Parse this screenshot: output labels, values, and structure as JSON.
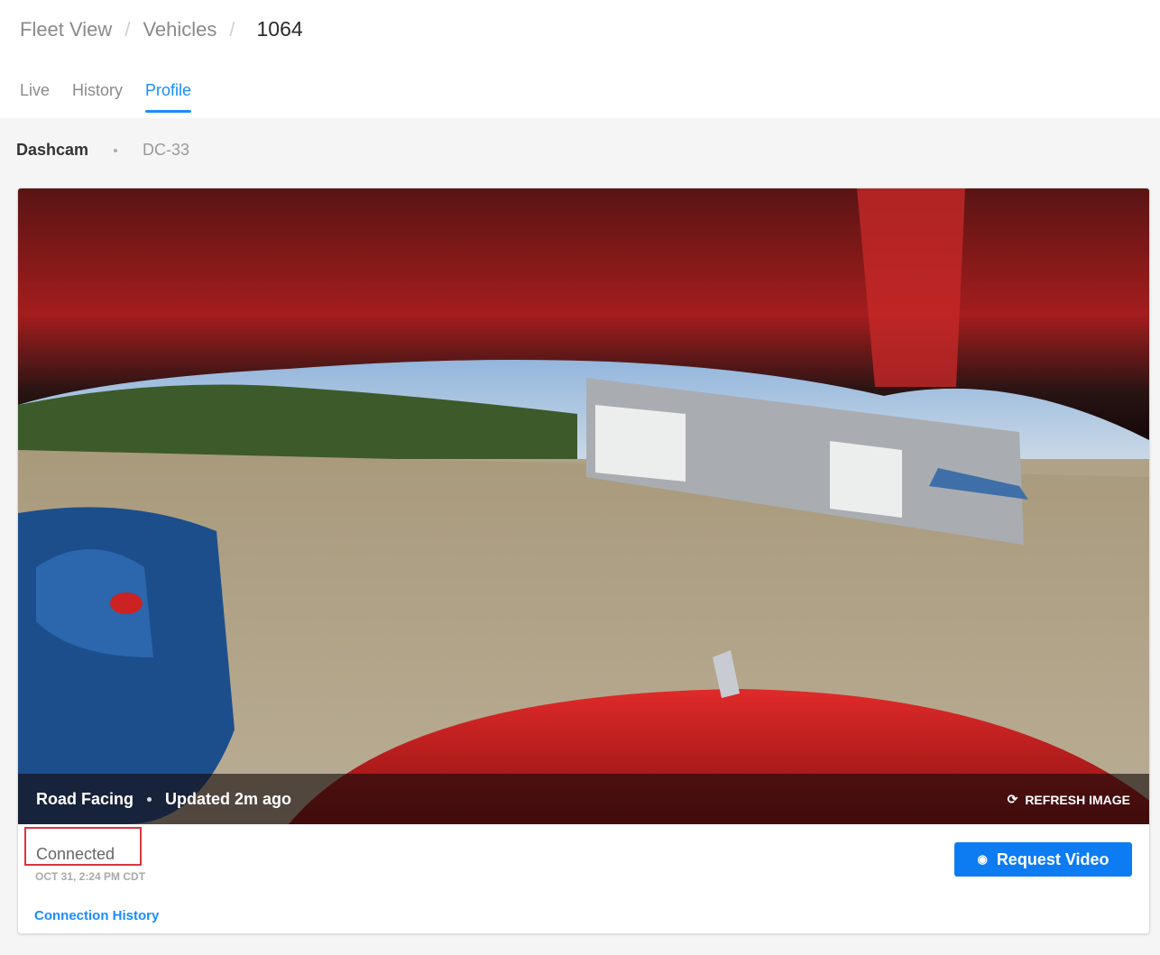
{
  "breadcrumb": {
    "items": [
      "Fleet View",
      "Vehicles"
    ],
    "current": "1064"
  },
  "tabs": [
    {
      "label": "Live"
    },
    {
      "label": "History"
    },
    {
      "label": "Profile",
      "active": true
    }
  ],
  "device": {
    "type": "Dashcam",
    "id": "DC-33"
  },
  "camera": {
    "view": "Road Facing",
    "updated": "Updated 2m ago",
    "refresh_label": "REFRESH IMAGE"
  },
  "connection": {
    "status": "Connected",
    "timestamp": "OCT 31, 2:24 PM CDT",
    "history_link": "Connection History"
  },
  "actions": {
    "request_video": "Request Video"
  },
  "colors": {
    "accent": "#1a8cff",
    "button": "#0d7cf2",
    "highlight": "#d9363e"
  }
}
